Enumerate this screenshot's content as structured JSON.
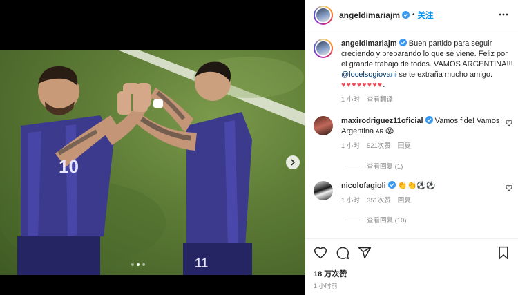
{
  "post": {
    "username": "angeldimariajm",
    "follow_label": "关注",
    "separator": "•"
  },
  "media": {
    "jersey_left": "10",
    "jersey_right_sleeve": "11",
    "carousel_dots": 3,
    "active_dot": 1
  },
  "caption": {
    "username": "angeldimariajm",
    "text_before_mention": "Buen partido para seguir creciendo y preparando lo que se viene. Feliz por el grande trabajo de todos. VAMOS ARGENTINA!!! ",
    "mention": "@locelsogiovani",
    "text_after_mention": " se te extraña mucho amigo. ",
    "hearts": "♥♥♥♥♥♥♥♥",
    "trailing": ".",
    "time": "1 小时",
    "translate_label": "查看翻译"
  },
  "comments": [
    {
      "username": "maxirodriguez11oficial",
      "text": "Vamos fide! Vamos Argentina",
      "flag": "AR",
      "emoji": "😱",
      "time": "1 小时",
      "likes": "521次赞",
      "reply_label": "回复",
      "view_replies": "查看回复 (1)"
    },
    {
      "username": "nicolofagioli",
      "text": "👏👏⚽⚽",
      "time": "1 小时",
      "likes": "351次赞",
      "reply_label": "回复",
      "view_replies": "查看回复 (10)"
    }
  ],
  "stats": {
    "likes": "18 万次赞",
    "posted": "1 小时前"
  },
  "colors": {
    "accent_blue": "#0095f6",
    "verified": "#3897f0",
    "mention": "#00376b",
    "hearts": "#ed4956",
    "secondary_text": "#8e8e8e"
  }
}
